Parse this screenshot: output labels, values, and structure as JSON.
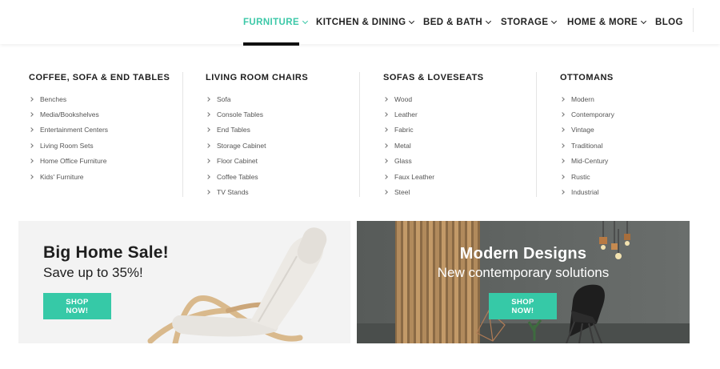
{
  "nav": {
    "items": [
      {
        "label": "FURNITURE",
        "active": true,
        "has_dropdown": true
      },
      {
        "label": "KITCHEN & DINING",
        "active": false,
        "has_dropdown": true
      },
      {
        "label": "BED & BATH",
        "active": false,
        "has_dropdown": true
      },
      {
        "label": "STORAGE",
        "active": false,
        "has_dropdown": true
      },
      {
        "label": "HOME & MORE",
        "active": false,
        "has_dropdown": true
      },
      {
        "label": "BLOG",
        "active": false,
        "has_dropdown": false
      }
    ],
    "active_color": "#3cc8a8"
  },
  "menu": {
    "columns": [
      {
        "title": "COFFEE, SOFA & END TABLES",
        "items": [
          "Benches",
          "Media/Bookshelves",
          "Entertainment Centers",
          "Living Room Sets",
          "Home Office Furniture",
          "Kids' Furniture"
        ]
      },
      {
        "title": "LIVING ROOM CHAIRS",
        "items": [
          "Sofa",
          "Console Tables",
          "End Tables",
          "Storage Cabinet",
          "Floor Cabinet",
          "Coffee Tables",
          "TV Stands"
        ]
      },
      {
        "title": "SOFAS & LOVESEATS",
        "items": [
          "Wood",
          "Leather",
          "Fabric",
          "Metal",
          "Glass",
          "Faux Leather",
          "Steel"
        ]
      },
      {
        "title": "OTTOMANS",
        "items": [
          "Modern",
          "Contemporary",
          "Vintage",
          "Traditional",
          "Mid-Century",
          "Rustic",
          "Industrial"
        ]
      }
    ]
  },
  "banners": {
    "left": {
      "title": "Big Home Sale!",
      "subtitle": "Save up to 35%!",
      "button": "SHOP NOW!",
      "image": "rocking-lounge-chair"
    },
    "right": {
      "title": "Modern Designs",
      "subtitle": "New contemporary solutions",
      "button": "SHOP NOW!",
      "image": "modern-black-chair-interior"
    }
  },
  "colors": {
    "accent": "#36c9a7",
    "banner_left_bg": "#f3f3f3",
    "banner_right_bg": "#5d6260"
  }
}
